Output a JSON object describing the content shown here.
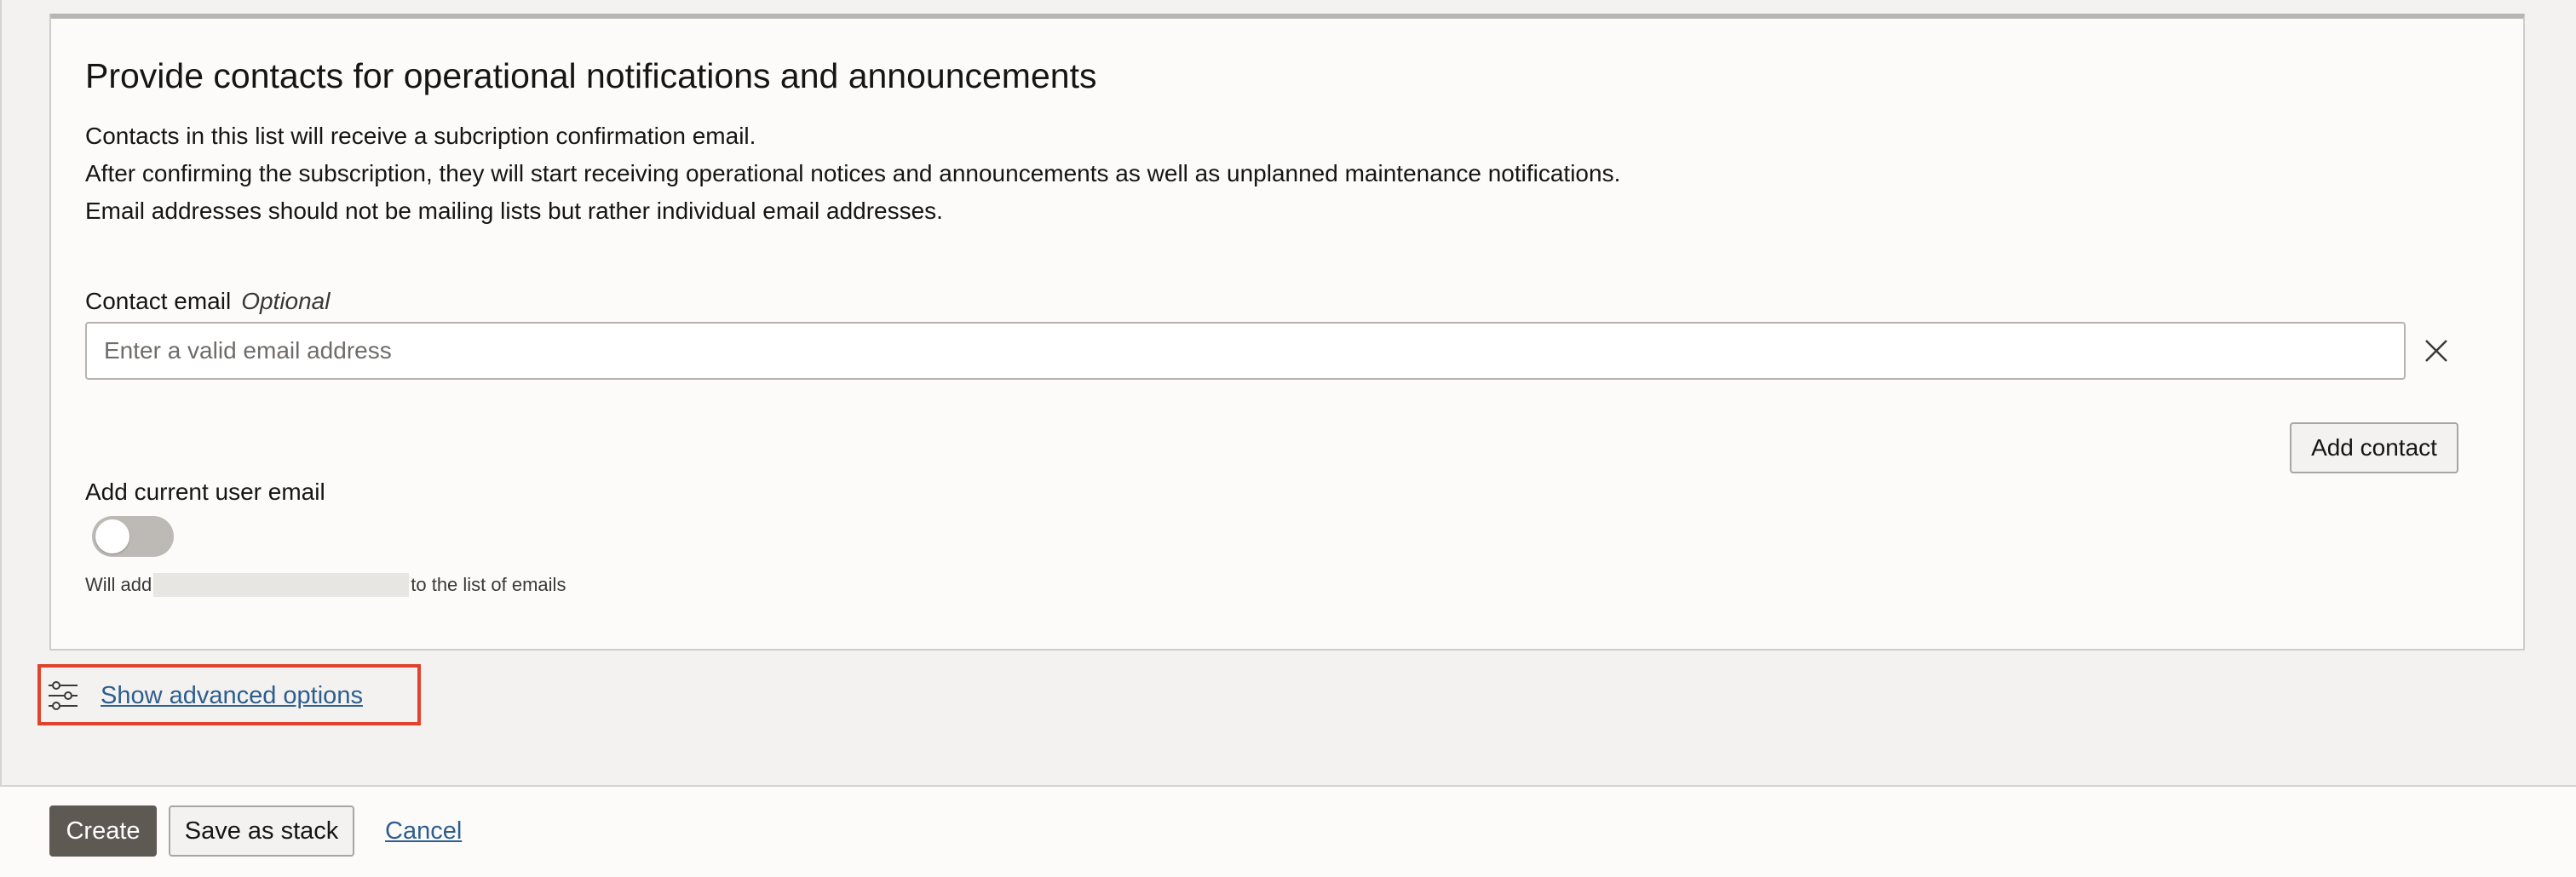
{
  "section": {
    "title": "Provide contacts for operational notifications and announcements",
    "description": [
      "Contacts in this list will receive a subcription confirmation email.",
      "After confirming the subscription, they will start receiving operational notices and announcements as well as unplanned maintenance notifications.",
      "Email addresses should not be mailing lists but rather individual email addresses."
    ]
  },
  "contact_email": {
    "label": "Contact email",
    "optional_label": "Optional",
    "value": "",
    "placeholder": "Enter a valid email address",
    "clear_icon": "close-icon"
  },
  "add_contact_label": "Add contact",
  "current_user": {
    "label": "Add current user email",
    "toggle_on": false,
    "helper_prefix": "Will add",
    "helper_suffix": "to the list of emails"
  },
  "advanced": {
    "label": "Show advanced options",
    "icon": "sliders-icon",
    "highlight_color": "#e0432b"
  },
  "footer": {
    "create_label": "Create",
    "save_stack_label": "Save as stack",
    "cancel_label": "Cancel"
  },
  "colors": {
    "link": "#2d5e8e",
    "primary_button": "#5f5954",
    "toggle_off": "#bdbab6"
  }
}
